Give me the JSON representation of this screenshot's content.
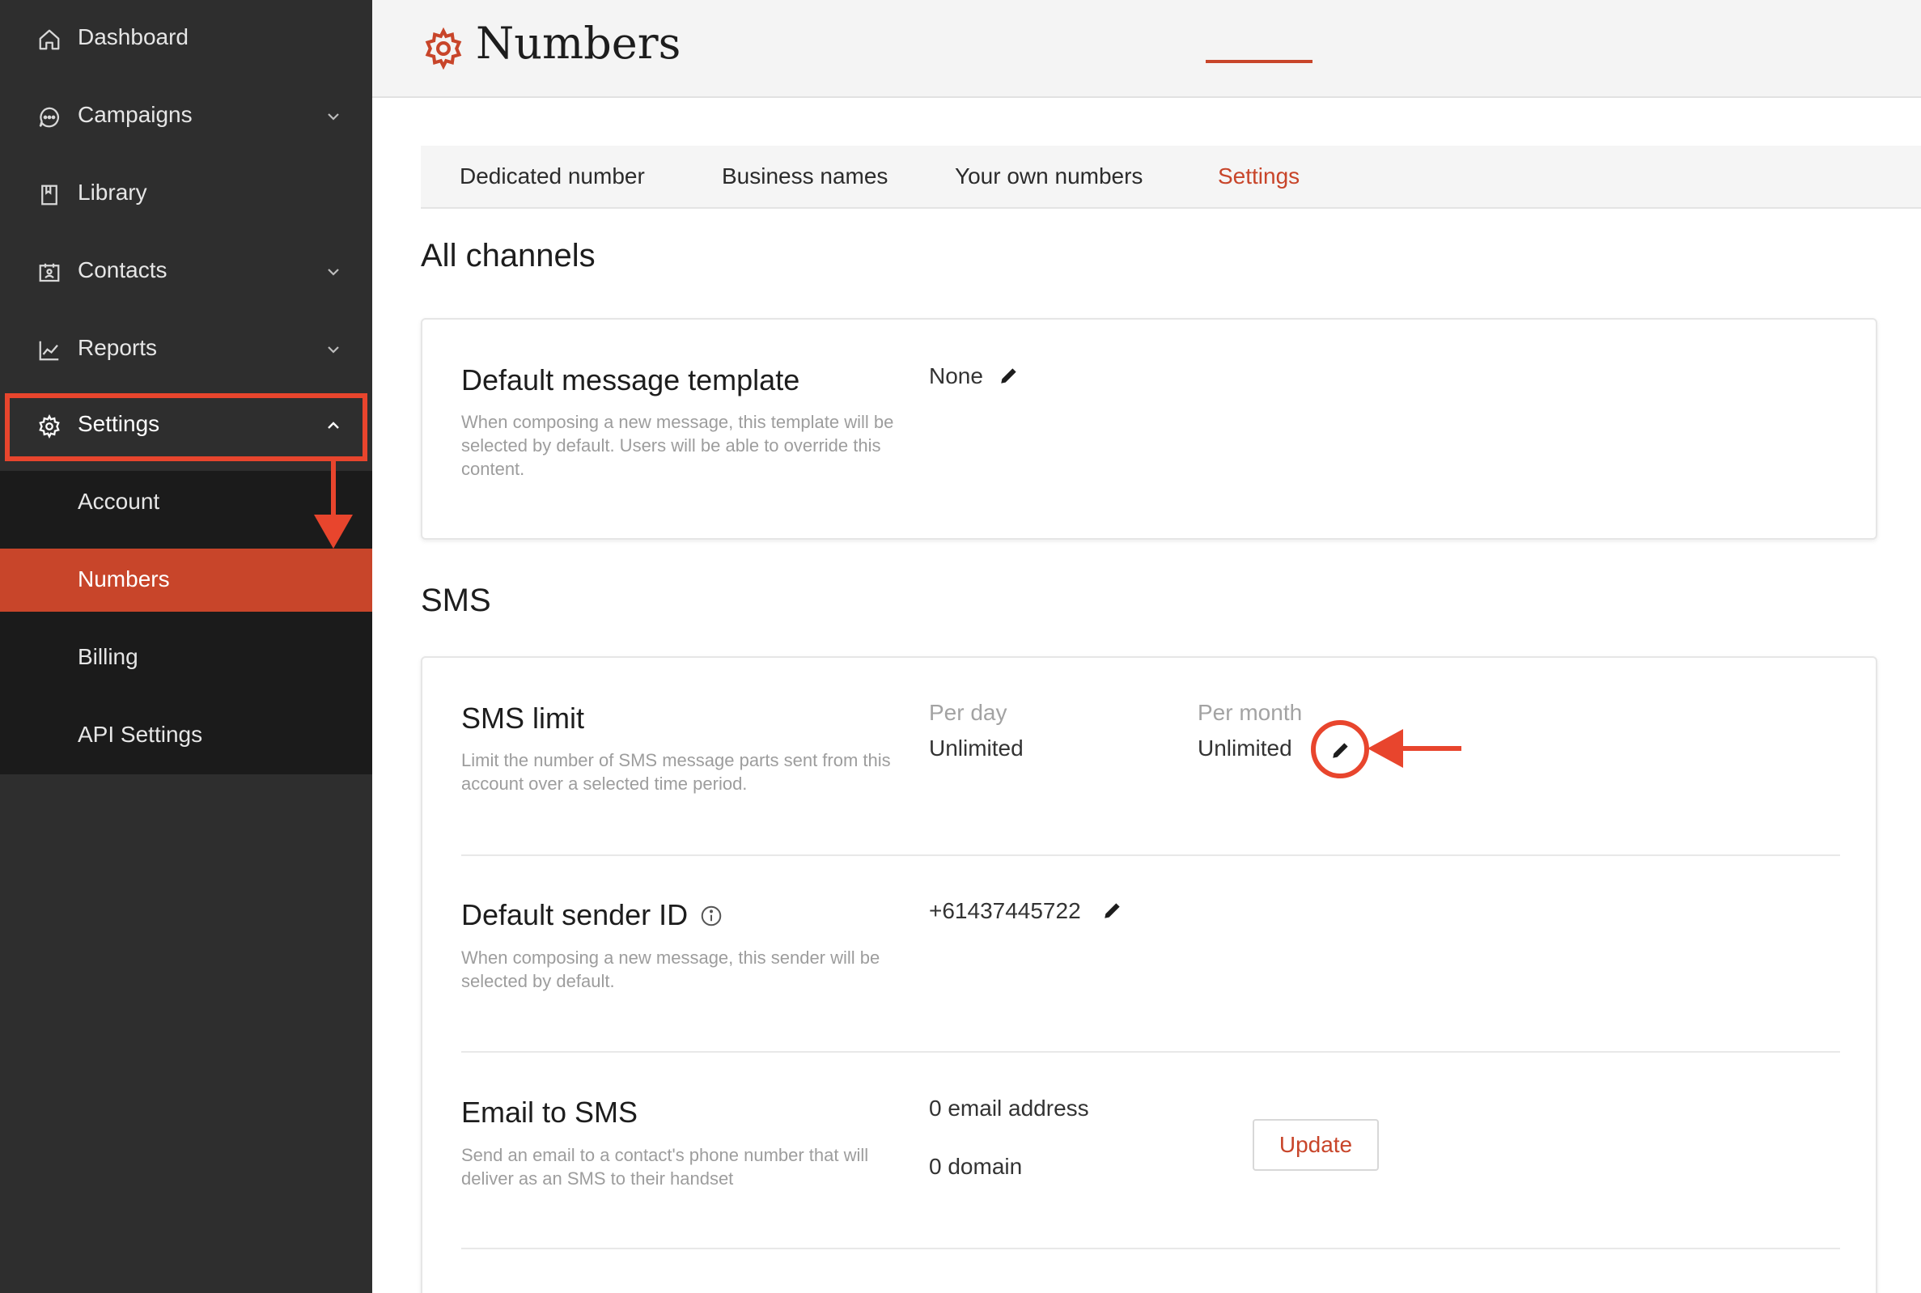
{
  "sidebar": {
    "items": [
      {
        "label": "Dashboard",
        "icon": "home-icon"
      },
      {
        "label": "Campaigns",
        "icon": "chat-bubble-icon"
      },
      {
        "label": "Library",
        "icon": "book-icon"
      },
      {
        "label": "Contacts",
        "icon": "contact-card-icon"
      },
      {
        "label": "Reports",
        "icon": "line-chart-icon"
      },
      {
        "label": "Settings",
        "icon": "gear-icon"
      }
    ],
    "submenu": [
      {
        "label": "Account"
      },
      {
        "label": "Numbers"
      },
      {
        "label": "Billing"
      },
      {
        "label": "API Settings"
      }
    ]
  },
  "header": {
    "title": "Numbers"
  },
  "tabs": [
    {
      "label": "Dedicated number"
    },
    {
      "label": "Business names"
    },
    {
      "label": "Your own numbers"
    },
    {
      "label": "Settings"
    }
  ],
  "all_channels": {
    "title": "All channels",
    "default_template": {
      "title": "Default message template",
      "description": "When composing a new message, this template will be selected by default. Users will be able to override this content.",
      "value": "None"
    }
  },
  "sms": {
    "title": "SMS",
    "limit": {
      "title": "SMS limit",
      "description": "Limit the number of SMS message parts sent from this account over a selected time period.",
      "per_day_label": "Per day",
      "per_day_value": "Unlimited",
      "per_month_label": "Per month",
      "per_month_value": "Unlimited"
    },
    "sender_id": {
      "title": "Default sender ID",
      "description": "When composing a new message, this sender will be selected by default.",
      "value": "+61437445722"
    },
    "email_to_sms": {
      "title": "Email to SMS",
      "description": "Send an email to a contact's phone number that will deliver as an SMS to their handset",
      "email_value": "0 email address",
      "domain_value": "0 domain",
      "update_label": "Update"
    }
  },
  "colors": {
    "accent": "#c8452a",
    "annotation": "#e8452d",
    "sidebar_bg": "#2e2e2e",
    "submenu_bg": "#1b1b1b"
  }
}
